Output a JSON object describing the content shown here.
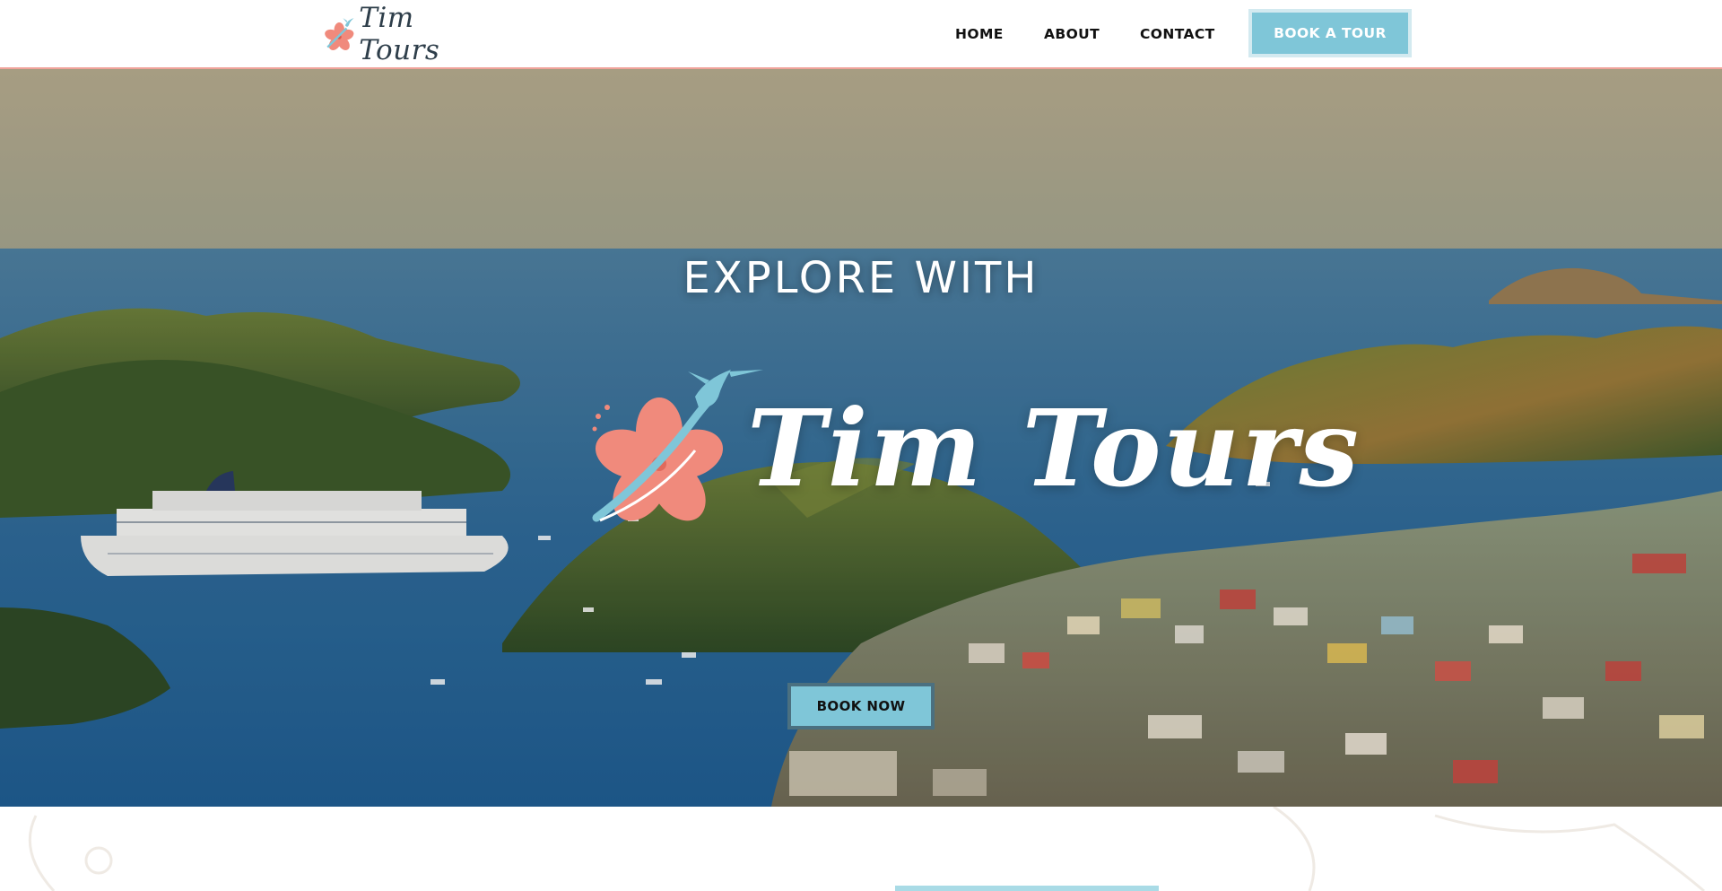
{
  "site": {
    "brand": "Tim Tours",
    "colors": {
      "accent": "#7fc6d8",
      "coral": "#f08a7c",
      "nav_text": "#111111",
      "header_border": "#f0a39a"
    }
  },
  "header": {
    "logo_text": "Tim Tours",
    "logo_icon": "hibiscus-hummingbird-icon",
    "nav": {
      "home": "HOME",
      "about": "ABOUT",
      "contact": "CONTACT"
    },
    "cta_label": "BOOK A TOUR"
  },
  "hero": {
    "heading": "EXPLORE WITH",
    "logo_text": "Tim Tours",
    "logo_icon": "hibiscus-hummingbird-icon",
    "cta_label": "BOOK NOW",
    "background": "harbor-aerial-image"
  }
}
